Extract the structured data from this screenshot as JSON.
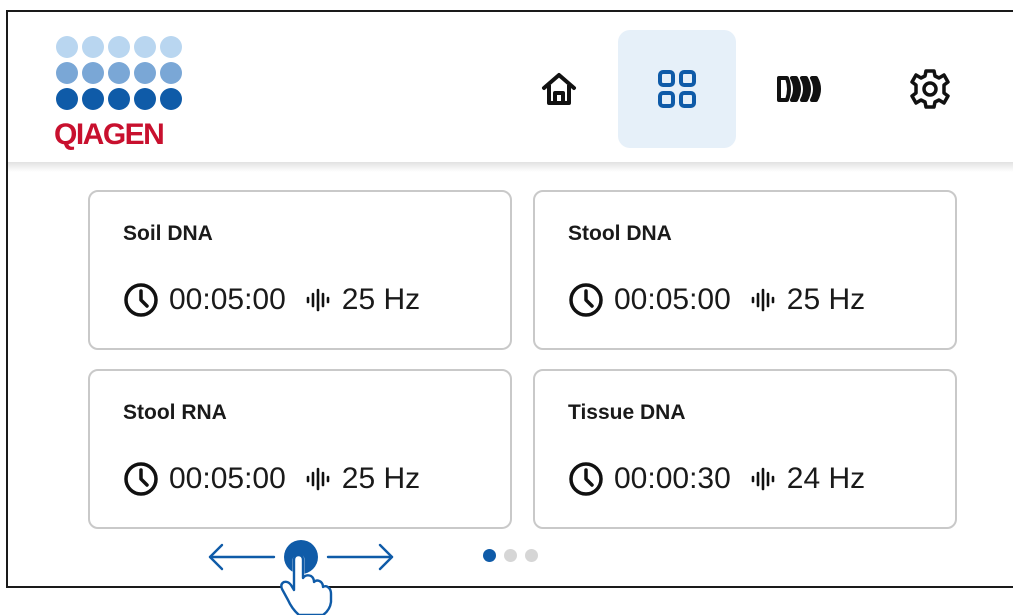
{
  "brand": {
    "logo_text": "QIAGEN",
    "colors": {
      "dot_row_1": "#b9d6f0",
      "dot_row_2": "#7aa7d6",
      "dot_row_3": "#0f5ba8",
      "text": "#c8102e"
    }
  },
  "nav": {
    "items": [
      {
        "name": "home",
        "icon": "home-icon",
        "active": false
      },
      {
        "name": "programs",
        "icon": "grid-icon",
        "active": true
      },
      {
        "name": "tubes",
        "icon": "tube-rack-icon",
        "active": false
      },
      {
        "name": "settings",
        "icon": "gear-icon",
        "active": false
      }
    ],
    "active_color": "#e6f0f9",
    "accent": "#0f5ba8"
  },
  "programs": [
    {
      "title": "Soil DNA",
      "time": "00:05:00",
      "frequency": "25 Hz"
    },
    {
      "title": "Stool DNA",
      "time": "00:05:00",
      "frequency": "25 Hz"
    },
    {
      "title": "Stool RNA",
      "time": "00:05:00",
      "frequency": "25 Hz"
    },
    {
      "title": "Tissue DNA",
      "time": "00:00:30",
      "frequency": "24 Hz"
    }
  ],
  "pagination": {
    "current_page": 1,
    "total_pages": 3
  },
  "gesture_hint": {
    "type": "swipe-horizontal",
    "icon": "hand-swipe-icon"
  }
}
